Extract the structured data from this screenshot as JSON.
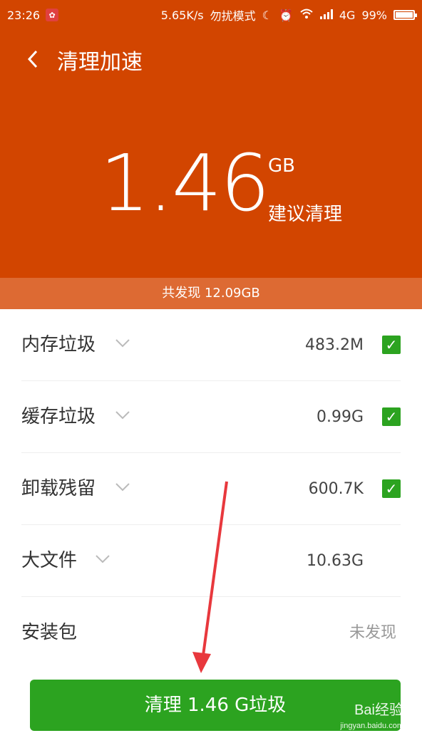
{
  "status_bar": {
    "time": "23:26",
    "network_speed": "5.65K/s",
    "mode": "勿扰模式",
    "network_type": "4G",
    "battery": "99%",
    "battery_level": 0.99
  },
  "header": {
    "title": "清理加速",
    "size_number": "1.46",
    "size_unit": "GB",
    "advice": "建议清理",
    "found_total": "共发现 12.09GB"
  },
  "items": [
    {
      "label": "内存垃圾",
      "value": "483.2M",
      "checked": true
    },
    {
      "label": "缓存垃圾",
      "value": "0.99G",
      "checked": true
    },
    {
      "label": "卸载残留",
      "value": "600.7K",
      "checked": true
    },
    {
      "label": "大文件",
      "value": "10.63G",
      "checked": false
    },
    {
      "label": "安装包",
      "value": "未发现",
      "checked": false
    }
  ],
  "clean_button": {
    "label": "清理 1.46 G垃圾"
  },
  "watermark": {
    "brand": "Bai经验",
    "url": "jingyan.baidu.com"
  },
  "colors": {
    "header": "#d24500",
    "found_bar": "#dd6a33",
    "accent_green": "#2ca320",
    "annotation_arrow": "#e8383d"
  }
}
